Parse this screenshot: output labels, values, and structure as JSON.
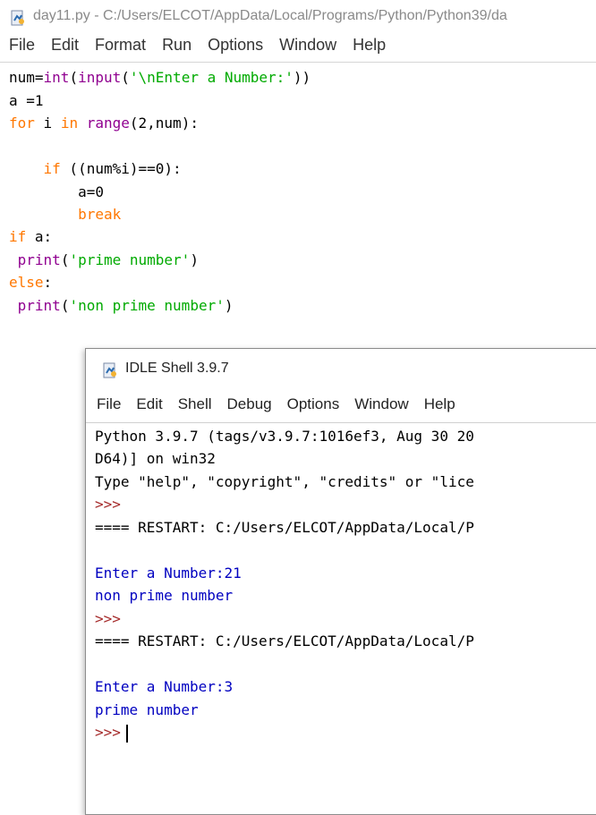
{
  "editor": {
    "title": "day11.py - C:/Users/ELCOT/AppData/Local/Programs/Python/Python39/da",
    "menu": [
      "File",
      "Edit",
      "Format",
      "Run",
      "Options",
      "Window",
      "Help"
    ],
    "code": {
      "l1": {
        "a": "num=",
        "b": "int",
        "c": "(",
        "d": "input",
        "e": "(",
        "f": "'\\nEnter a Number:'",
        "g": "))"
      },
      "l2": "a =1",
      "l3": {
        "a": "for",
        "b": " i ",
        "c": "in",
        "d": " ",
        "e": "range",
        "f": "(2,num):"
      },
      "l5": {
        "pad": "    ",
        "a": "if",
        "b": " ((num%i)==0):"
      },
      "l6": "        a=0",
      "l7": {
        "pad": "        ",
        "a": "break"
      },
      "l8": {
        "a": "if",
        "b": " a:"
      },
      "l9": {
        "pad": " ",
        "a": "print",
        "b": "(",
        "c": "'prime number'",
        "d": ")"
      },
      "l10": {
        "a": "else",
        "b": ":"
      },
      "l11": {
        "pad": " ",
        "a": "print",
        "b": "(",
        "c": "'non prime number'",
        "d": ")"
      }
    }
  },
  "shell": {
    "title": "IDLE Shell 3.9.7",
    "menu": [
      "File",
      "Edit",
      "Shell",
      "Debug",
      "Options",
      "Window",
      "Help"
    ],
    "lines": {
      "s1": "Python 3.9.7 (tags/v3.9.7:1016ef3, Aug 30 20",
      "s2": "D64)] on win32",
      "s3": "Type \"help\", \"copyright\", \"credits\" or \"lice",
      "s4": ">>>",
      "s5": "==== RESTART: C:/Users/ELCOT/AppData/Local/P",
      "s7": "Enter a Number:21",
      "s8": "non prime number",
      "s9": ">>>",
      "s10": "==== RESTART: C:/Users/ELCOT/AppData/Local/P",
      "s12": "Enter a Number:3",
      "s13": "prime number",
      "s14": ">>>"
    }
  },
  "colors": {
    "keyword": "#ff7700",
    "builtin": "#900090",
    "string": "#00aa00",
    "output": "#0000c0",
    "prompt": "#a52a2a"
  }
}
